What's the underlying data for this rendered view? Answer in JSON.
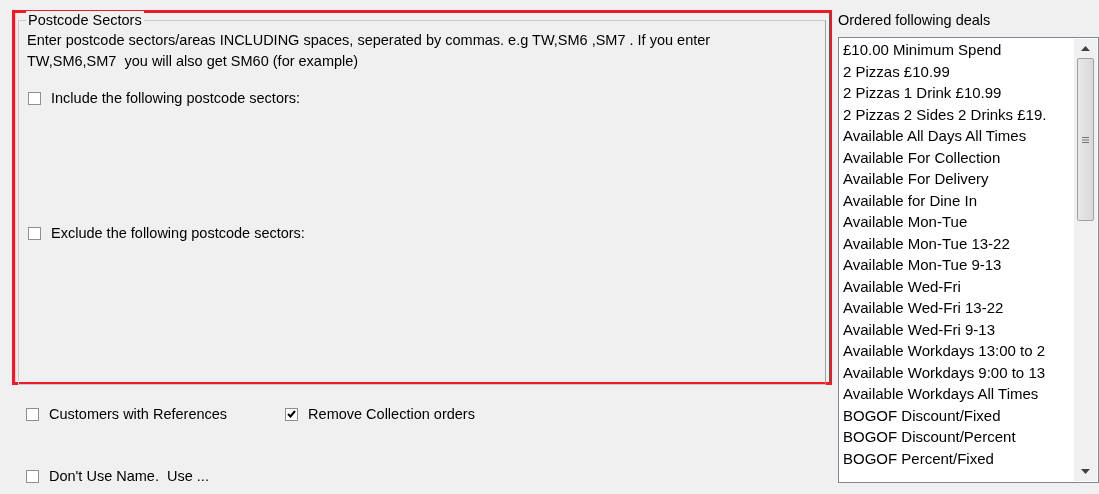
{
  "postcode_sectors": {
    "title": "Postcode Sectors",
    "instructions": [
      "Enter postcode sectors/areas INCLUDING spaces, seperated by commas. e.g TW,SM6 ,SM7 . If you enter",
      "TW,SM6,SM7  you will also get SM60 (for example)"
    ],
    "options": [
      {
        "label": "Include the following postcode sectors:",
        "checked": false
      },
      {
        "label": "Exclude the following postcode sectors:",
        "checked": false
      }
    ]
  },
  "options": [
    {
      "label": "Customers with References",
      "checked": false
    },
    {
      "label": "Remove Collection orders",
      "checked": true
    },
    {
      "label": "Don't Use Name.  Use ...",
      "checked": false
    }
  ],
  "deals": {
    "label": "Ordered following deals",
    "items": [
      "£10.00 Minimum Spend",
      "2 Pizzas £10.99",
      "2 Pizzas 1 Drink £10.99",
      "2 Pizzas 2 Sides 2 Drinks £19.",
      "Available All Days All Times",
      "Available For Collection",
      "Available For Delivery",
      "Available for Dine In",
      "Available Mon-Tue",
      "Available Mon-Tue 13-22",
      "Available Mon-Tue 9-13",
      "Available Wed-Fri",
      "Available Wed-Fri 13-22",
      "Available Wed-Fri 9-13",
      "Available Workdays 13:00 to 2",
      "Available Workdays 9:00 to 13",
      "Available Workdays All Times",
      "BOGOF Discount/Fixed",
      "BOGOF Discount/Percent",
      "BOGOF Percent/Fixed"
    ]
  }
}
